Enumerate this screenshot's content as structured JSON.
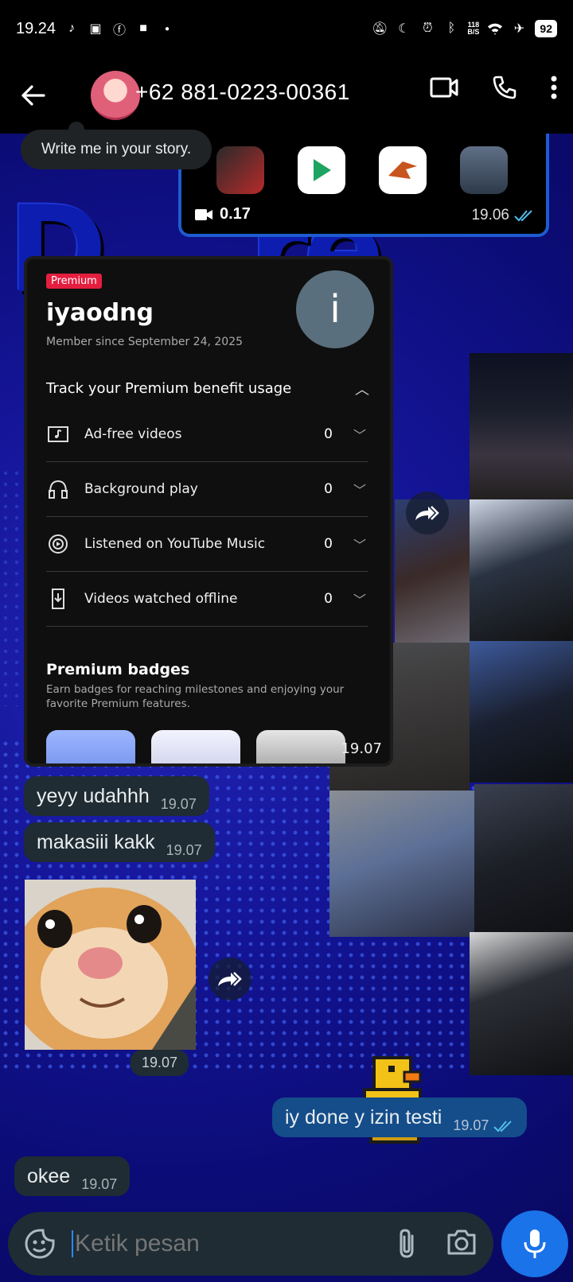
{
  "status_bar": {
    "time": "19.24",
    "speed_value": "118",
    "speed_unit": "B/S",
    "battery": "92"
  },
  "header": {
    "contact_name": "+62 881-0223-00361"
  },
  "story_tooltip": "Write me in your story.",
  "video_message": {
    "duration": "0.17",
    "time": "19.06"
  },
  "youtube_card": {
    "badge": "Premium",
    "username": "iyaodng",
    "member_since": "Member since September 24, 2025",
    "avatar_letter": "i",
    "track_title": "Track your Premium benefit usage",
    "rows": [
      {
        "label": "Ad-free videos",
        "count": "0"
      },
      {
        "label": "Background play",
        "count": "0"
      },
      {
        "label": "Listened on YouTube Music",
        "count": "0"
      },
      {
        "label": "Videos watched offline",
        "count": "0"
      }
    ],
    "badges_title": "Premium badges",
    "badges_desc": "Earn badges for reaching milestones and enjoying your favorite Premium features.",
    "time": "19.07"
  },
  "messages": [
    {
      "text": "yeyy udahhh",
      "time": "19.07"
    },
    {
      "text": "makasiii kakk",
      "time": "19.07"
    },
    {
      "sticker_time": "19.07"
    },
    {
      "text": "iy done y izin testi",
      "time": "19.07"
    },
    {
      "text": "okee",
      "time": "19.07"
    }
  ],
  "input": {
    "placeholder": "Ketik pesan"
  },
  "colors": {
    "accent": "#1a73e8",
    "outgoing_bubble": "#144d8a",
    "incoming_bubble": "#1f2c33",
    "premium_red": "#e41e3f"
  }
}
